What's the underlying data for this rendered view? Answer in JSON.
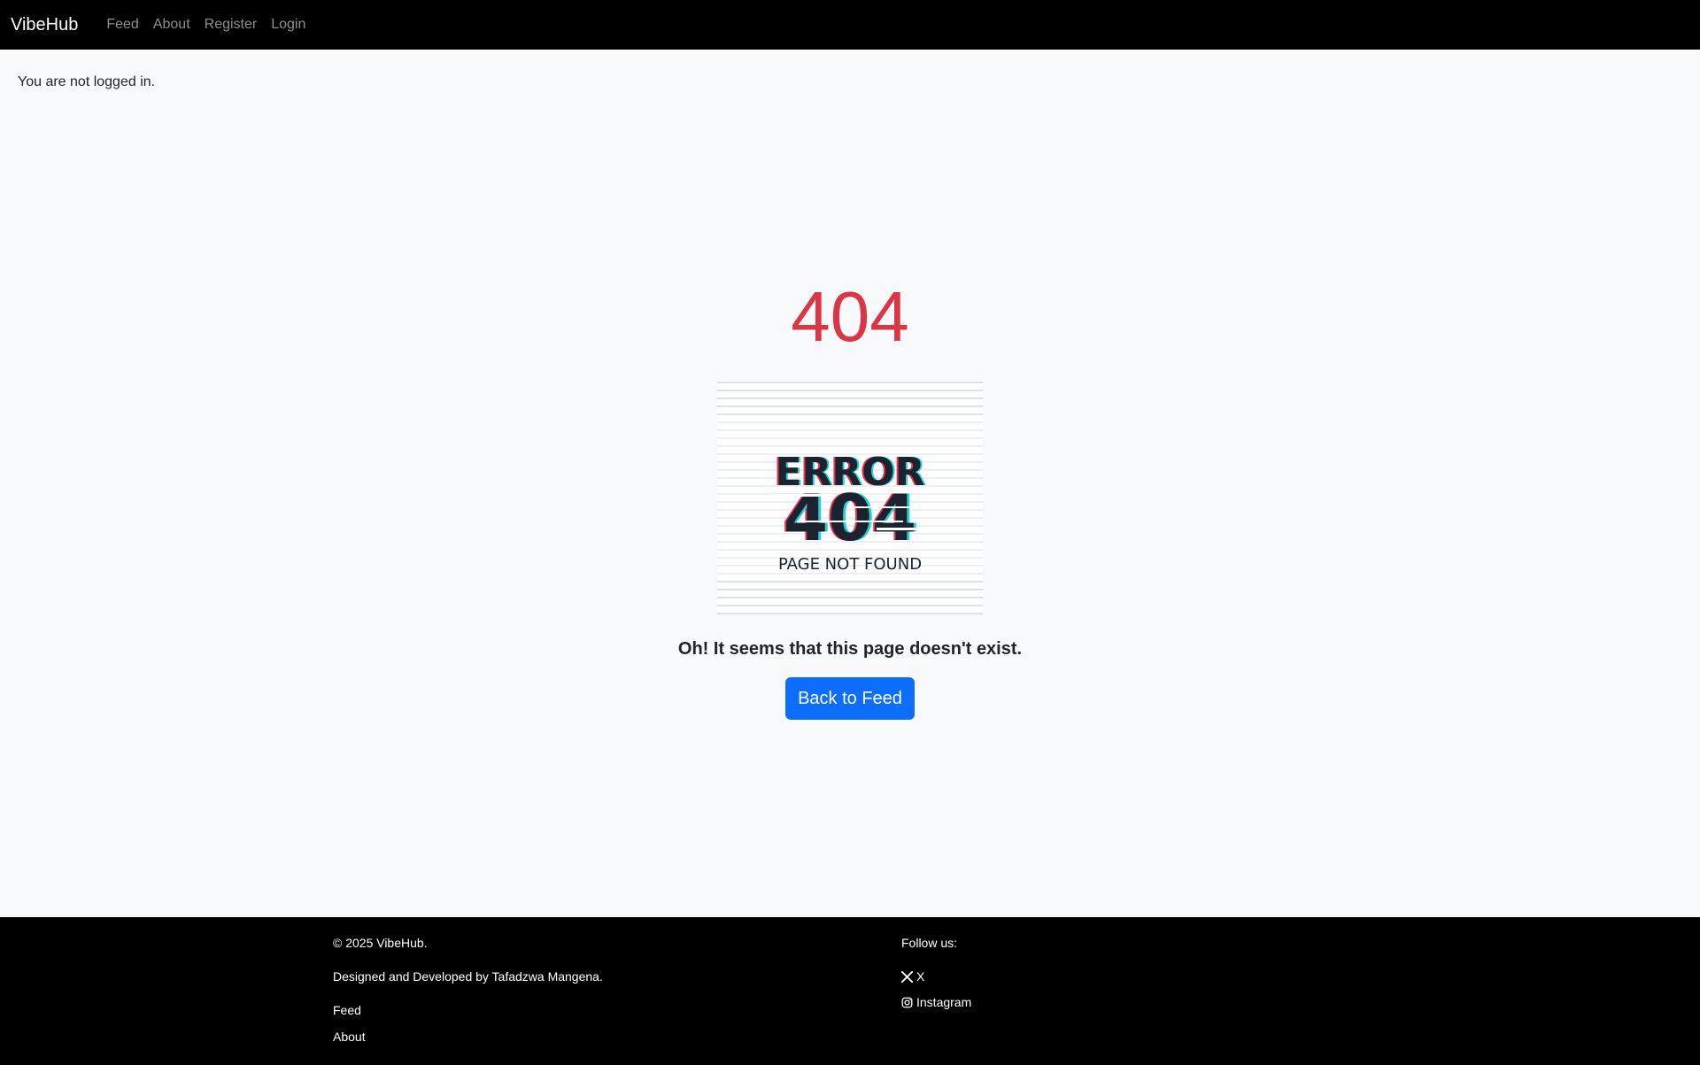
{
  "navbar": {
    "brand": "VibeHub",
    "links": [
      "Feed",
      "About",
      "Register",
      "Login"
    ]
  },
  "auth_status": "You are not logged in.",
  "error": {
    "code": "404",
    "image_text": {
      "title": "ERROR",
      "code": "404",
      "subtitle": "PAGE NOT FOUND"
    },
    "message": "Oh! It seems that this page doesn't exist.",
    "button_label": "Back to Feed"
  },
  "footer": {
    "copyright": "© 2025 VibeHub.",
    "credit": "Designed and Developed by Tafadzwa Mangena.",
    "links": [
      "Feed",
      "About"
    ],
    "follow_label": "Follow us:",
    "social": [
      {
        "label": "X",
        "icon": "x-icon"
      },
      {
        "label": "Instagram",
        "icon": "instagram-icon"
      }
    ]
  },
  "colors": {
    "navbar_bg": "#000000",
    "error_code": "#dc3545",
    "primary_button": "#0d6efd",
    "page_bg": "#f8f9fa"
  }
}
